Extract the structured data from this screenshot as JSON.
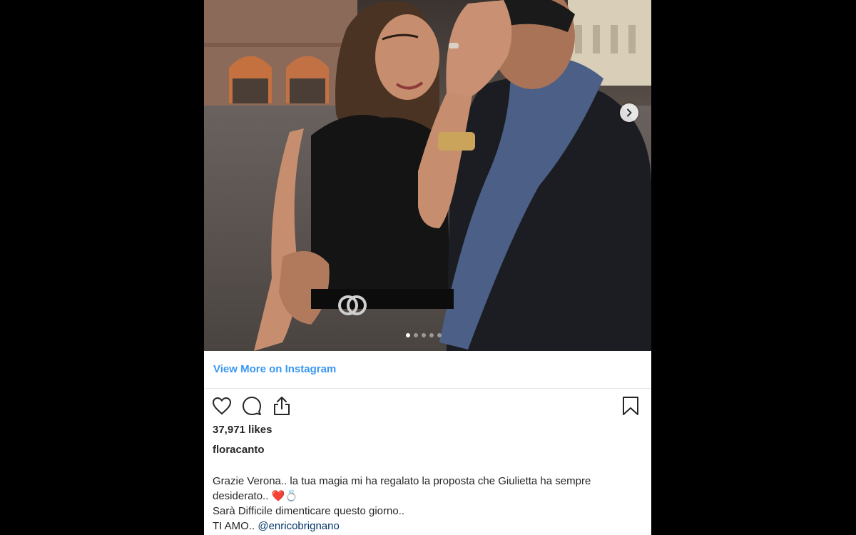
{
  "post": {
    "photo": {
      "description_icon": "photo-couple-verona",
      "carousel": {
        "count": 5,
        "active_index": 0
      },
      "next_icon": "chevron-right-icon"
    },
    "view_more_label": "View More on Instagram",
    "actions": {
      "like_icon": "heart-icon",
      "comment_icon": "comment-icon",
      "share_icon": "share-icon",
      "save_icon": "bookmark-icon"
    },
    "likes": "37,971 likes",
    "username": "floracanto",
    "caption": {
      "line1": "Grazie Verona.. la tua magia mi ha regalato la proposta che Giulietta ha sempre",
      "line2_text": "desiderato.. ",
      "line2_emoji_heart": "❤️",
      "line2_emoji_ring": "💍",
      "line3": "Sarà Difficile dimenticare questo giorno..",
      "line4_text": "TI AMO.. ",
      "line4_mention": "@enricobrignano"
    }
  },
  "colors": {
    "background": "#000000",
    "card": "#ffffff",
    "link_blue": "#3897f0",
    "mention": "#003569",
    "text": "#262626"
  }
}
